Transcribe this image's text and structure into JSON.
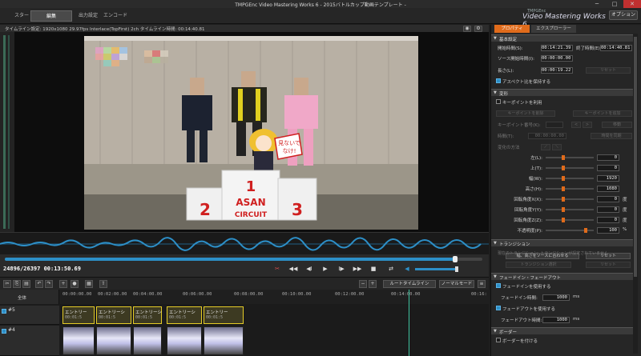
{
  "window": {
    "title": "TMPGEnc Video Mastering Works 6 - 2015バトルカップ動画テンプレート -",
    "min": "─",
    "max": "□",
    "close": "✕"
  },
  "nav": {
    "tabs": [
      "スタート",
      "編集",
      "出力設定",
      "エンコード"
    ],
    "active_index": 1,
    "brand_small": "TMPGEnc",
    "brand": "Video Mastering Works 6",
    "options_label": "オプション"
  },
  "preview": {
    "info": "タイムライン設定:  1920x1080 29.97fps Interlace(TopFirst) 2ch   タイムライン時間: 00:14:40.81",
    "podium_nums": [
      "2",
      "1",
      "3"
    ],
    "podium_text1": "ASAN",
    "podium_text2": "CIRCUIT",
    "sign_text": "見ないで\nなけ!"
  },
  "transport": {
    "frame": "24896/26397",
    "time": "00:13:50.69",
    "progress": 0.943,
    "volume": 0.9,
    "buttons": [
      "✂",
      "◀◀",
      "◀I",
      "▶",
      "I▶",
      "▶▶",
      "■",
      "⇄",
      "◀"
    ]
  },
  "timeline": {
    "mode_dropdown": "ルートタイムライン",
    "view_dropdown": "ノーマルモード",
    "ruler_label": "全体",
    "ticks": [
      "00:00:00.00",
      "00:02:00.00",
      "00:04:00.00",
      "00:06:00.00",
      "00:08:00.00",
      "00:10:00.00",
      "00:12:00.00",
      "00:14:00.00",
      "00:16:"
    ],
    "tracks": [
      "#5",
      "#4"
    ],
    "clips": [
      {
        "label": "エントリー",
        "tc": "00:01:5"
      },
      {
        "label": "エントリーシ",
        "tc": "00:01:5"
      },
      {
        "label": "エントリーシ",
        "tc": "00:01:5"
      },
      {
        "label": "エントリーシ",
        "tc": "00:01:5"
      },
      {
        "label": "エントリー",
        "tc": "00:01:5"
      }
    ]
  },
  "panel": {
    "tabs": [
      "プロパティ",
      "エクスプローラー"
    ],
    "basic": {
      "header": "基本設定",
      "start_label": "開始時間(S):",
      "start_value": "00:14:21.39",
      "end_label": "終了時間(E):",
      "end_value": "00:14:40.81",
      "src_start_label": "ソース開始時間(I):",
      "src_start_value": "00:00:00.00",
      "length_label": "長さ(L):",
      "length_value": "00:00:19.22",
      "reset": "リセット",
      "aspect_label": "アスペクト比を保持する"
    },
    "transform": {
      "header": "変形",
      "keypoint_label": "キーポイントを利用",
      "kp_delete": "キーポイントを削除",
      "kp_add": "キーポイントを追加",
      "kp_num_label": "キーポイント番号(K):",
      "kp_prev": "<",
      "kp_next": ">",
      "kp_move": "移動",
      "time_label": "時間(T):",
      "time_value": "00:00:00.00",
      "time_sync": "時間を同期",
      "method_label": "変化の方法",
      "rows": [
        {
          "label": "左(L):",
          "value": "0",
          "unit": ""
        },
        {
          "label": "上(T):",
          "value": "0",
          "unit": ""
        },
        {
          "label": "幅(W):",
          "value": "1920",
          "unit": ""
        },
        {
          "label": "高さ(H):",
          "value": "1080",
          "unit": ""
        },
        {
          "label": "回転角度X(X):",
          "value": "0",
          "unit": "度"
        },
        {
          "label": "回転角度Y(Y):",
          "value": "0",
          "unit": "度"
        },
        {
          "label": "回転角度Z(Z):",
          "value": "0",
          "unit": "度"
        },
        {
          "label": "不透明度(P):",
          "value": "100",
          "unit": "%"
        }
      ],
      "fit_source": "幅、高さをソースに合わせる",
      "reset": "リセット"
    },
    "transition": {
      "header": "トランジション",
      "desc": "現在のトランジション: トランジションが設定されていません",
      "select": "トランジション選択",
      "reset": "リセット"
    },
    "fade": {
      "header": "フェードイン・フェードアウト",
      "fadein_label": "フェードインを使用する",
      "fadein_time_label": "フェードイン時間:",
      "fadein_value": "1000",
      "fadeout_label": "フェードアウトを使用する",
      "fadeout_time_label": "フェードアウト時間:",
      "fadeout_value": "1000",
      "unit": "ms"
    },
    "border": {
      "header": "ボーダー",
      "label": "ボーダーを付ける"
    }
  }
}
